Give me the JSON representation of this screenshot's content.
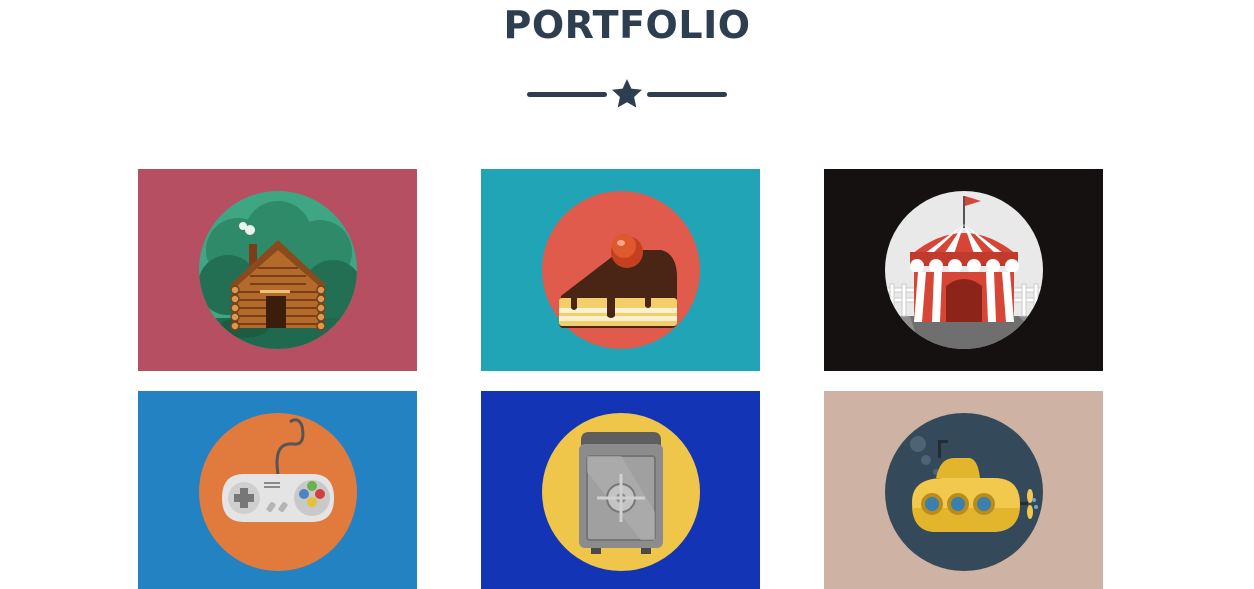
{
  "section": {
    "title": "PORTFOLIO"
  },
  "divider": {
    "icon": "star-icon",
    "color": "#2c3e50"
  },
  "portfolio": {
    "items": [
      {
        "icon": "log-cabin-icon",
        "background": "#b74f63"
      },
      {
        "icon": "cake-slice-icon",
        "background": "#21a4b6"
      },
      {
        "icon": "circus-tent-icon",
        "background": "#151110"
      },
      {
        "icon": "game-controller-icon",
        "background": "#2282c2"
      },
      {
        "icon": "safe-icon",
        "background": "#1234b5"
      },
      {
        "icon": "submarine-icon",
        "background": "#ceb2a3"
      }
    ]
  }
}
